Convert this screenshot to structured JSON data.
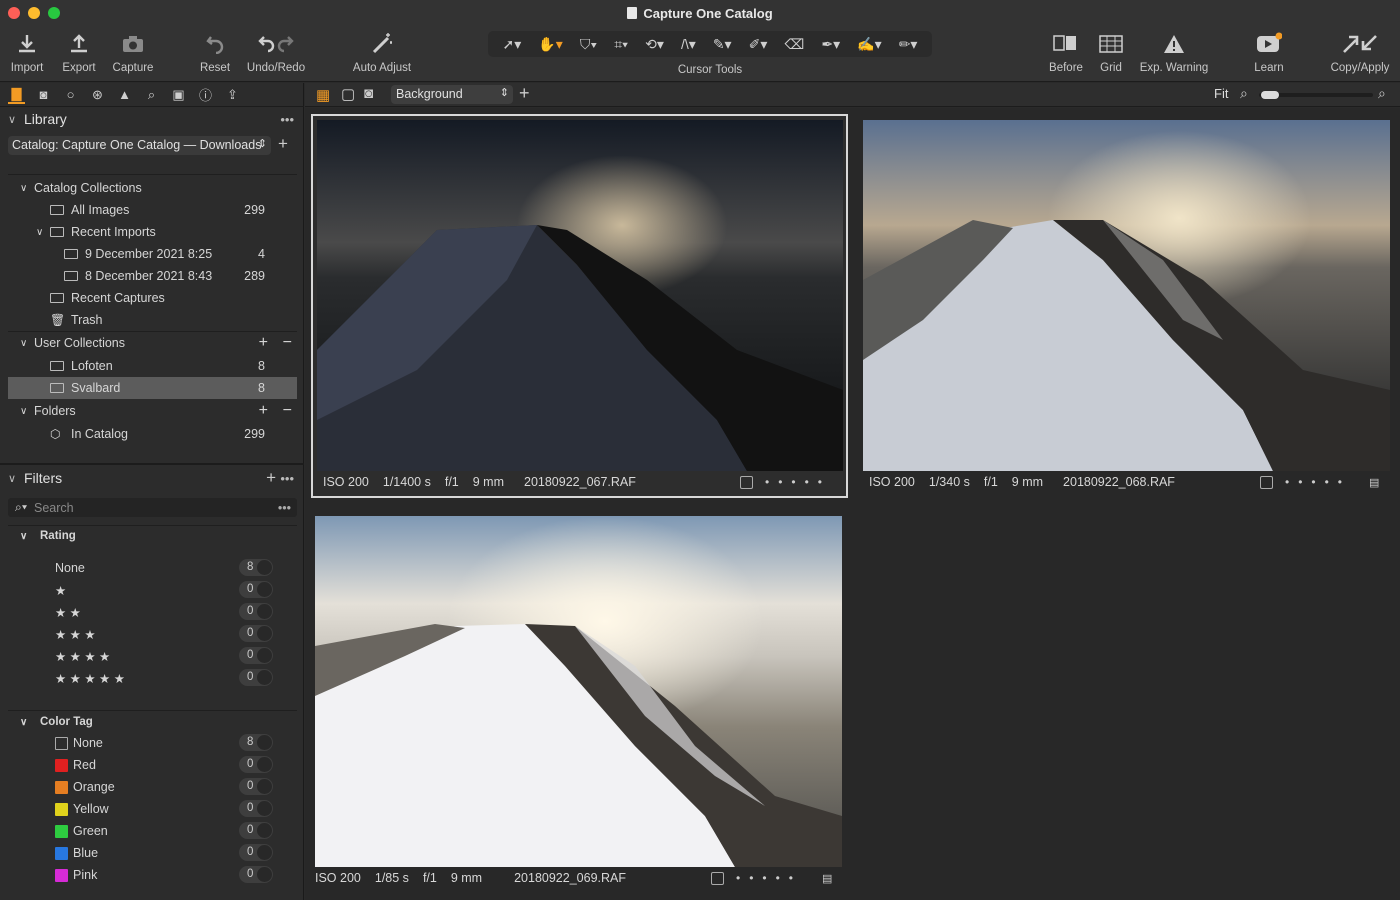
{
  "window": {
    "title": "Capture One Catalog"
  },
  "toolbar": {
    "import": "Import",
    "export": "Export",
    "capture": "Capture",
    "reset": "Reset",
    "undo_redo": "Undo/Redo",
    "auto_adjust": "Auto Adjust",
    "cursor_tools": "Cursor Tools",
    "before": "Before",
    "grid": "Grid",
    "exp_warning": "Exp. Warning",
    "learn": "Learn",
    "copy_apply": "Copy/Apply"
  },
  "library": {
    "title": "Library",
    "catalog_select": "Catalog: Capture One Catalog — Downloads",
    "catalog_collections": "Catalog Collections",
    "all_images": {
      "label": "All Images",
      "count": "299"
    },
    "recent_imports": "Recent Imports",
    "import1": {
      "label": "9 December 2021 8:25",
      "count": "4"
    },
    "import2": {
      "label": "8 December 2021 8:43",
      "count": "289"
    },
    "recent_captures": "Recent Captures",
    "trash": "Trash",
    "user_collections": "User Collections",
    "lofoten": {
      "label": "Lofoten",
      "count": "8"
    },
    "svalbard": {
      "label": "Svalbard",
      "count": "8"
    },
    "folders": "Folders",
    "in_catalog": {
      "label": "In Catalog",
      "count": "299"
    }
  },
  "filters": {
    "title": "Filters",
    "search_placeholder": "Search",
    "rating_title": "Rating",
    "ratings": [
      {
        "label": "None",
        "count": "8"
      },
      {
        "label": "★",
        "count": "0"
      },
      {
        "label": "★ ★",
        "count": "0"
      },
      {
        "label": "★ ★ ★",
        "count": "0"
      },
      {
        "label": "★ ★ ★ ★",
        "count": "0"
      },
      {
        "label": "★ ★ ★ ★ ★",
        "count": "0"
      }
    ],
    "color_title": "Color Tag",
    "colors": [
      {
        "label": "None",
        "count": "8",
        "color": "transparent"
      },
      {
        "label": "Red",
        "count": "0",
        "color": "#e02020"
      },
      {
        "label": "Orange",
        "count": "0",
        "color": "#e67e22"
      },
      {
        "label": "Yellow",
        "count": "0",
        "color": "#e0d21c"
      },
      {
        "label": "Green",
        "count": "0",
        "color": "#2ecc40"
      },
      {
        "label": "Blue",
        "count": "0",
        "color": "#2878e0"
      },
      {
        "label": "Pink",
        "count": "0",
        "color": "#d62bd6"
      }
    ]
  },
  "viewer": {
    "background_select": "Background",
    "zoom_label": "Fit",
    "accent": "#f29b24"
  },
  "images": [
    {
      "iso": "ISO 200",
      "shutter": "1/1400 s",
      "aperture": "f/1",
      "focal": "9 mm",
      "file": "20180922_067.RAF"
    },
    {
      "iso": "ISO 200",
      "shutter": "1/340 s",
      "aperture": "f/1",
      "focal": "9 mm",
      "file": "20180922_068.RAF"
    },
    {
      "iso": "ISO 200",
      "shutter": "1/85 s",
      "aperture": "f/1",
      "focal": "9 mm",
      "file": "20180922_069.RAF"
    }
  ]
}
